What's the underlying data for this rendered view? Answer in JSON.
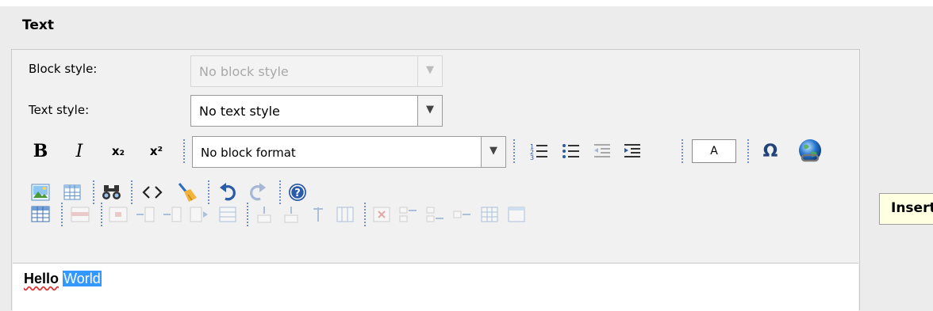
{
  "section": {
    "title": "Text"
  },
  "block_style": {
    "label": "Block style:",
    "value": "No block style",
    "disabled": true
  },
  "text_style": {
    "label": "Text style:",
    "value": "No text style"
  },
  "toolbar1": {
    "bold": "B",
    "italic": "I",
    "subscript": "x₂",
    "superscript": "x²",
    "block_format": "No block format",
    "font_size_box": "A",
    "special_char": "Ω"
  },
  "tooltip": {
    "text": "Insert link"
  },
  "editor": {
    "word1": "Hello",
    "word2": "World"
  }
}
